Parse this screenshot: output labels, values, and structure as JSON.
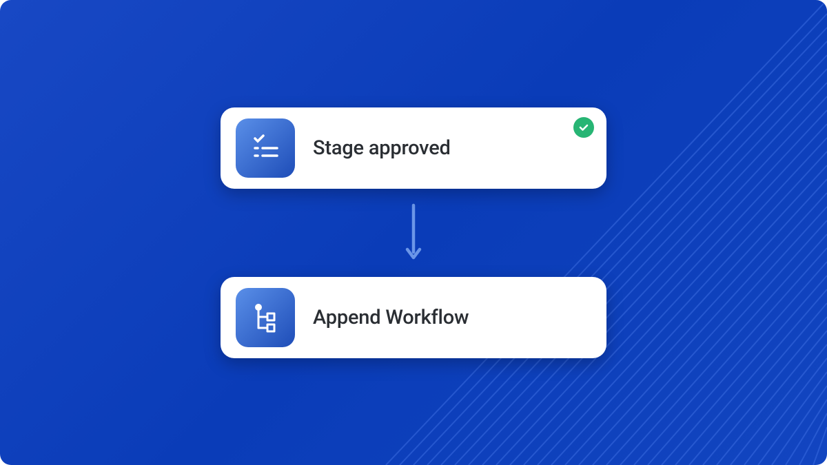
{
  "colors": {
    "background_primary": "#1848c4",
    "card_bg": "#ffffff",
    "icon_bg_start": "#5a8fe8",
    "icon_bg_end": "#1e4db8",
    "text": "#2a2e33",
    "success_badge": "#27b574",
    "arrow": "#6b96e8"
  },
  "cards": [
    {
      "icon": "checklist-icon",
      "label": "Stage approved",
      "status": "success"
    },
    {
      "icon": "workflow-tree-icon",
      "label": "Append Workflow",
      "status": null
    }
  ]
}
